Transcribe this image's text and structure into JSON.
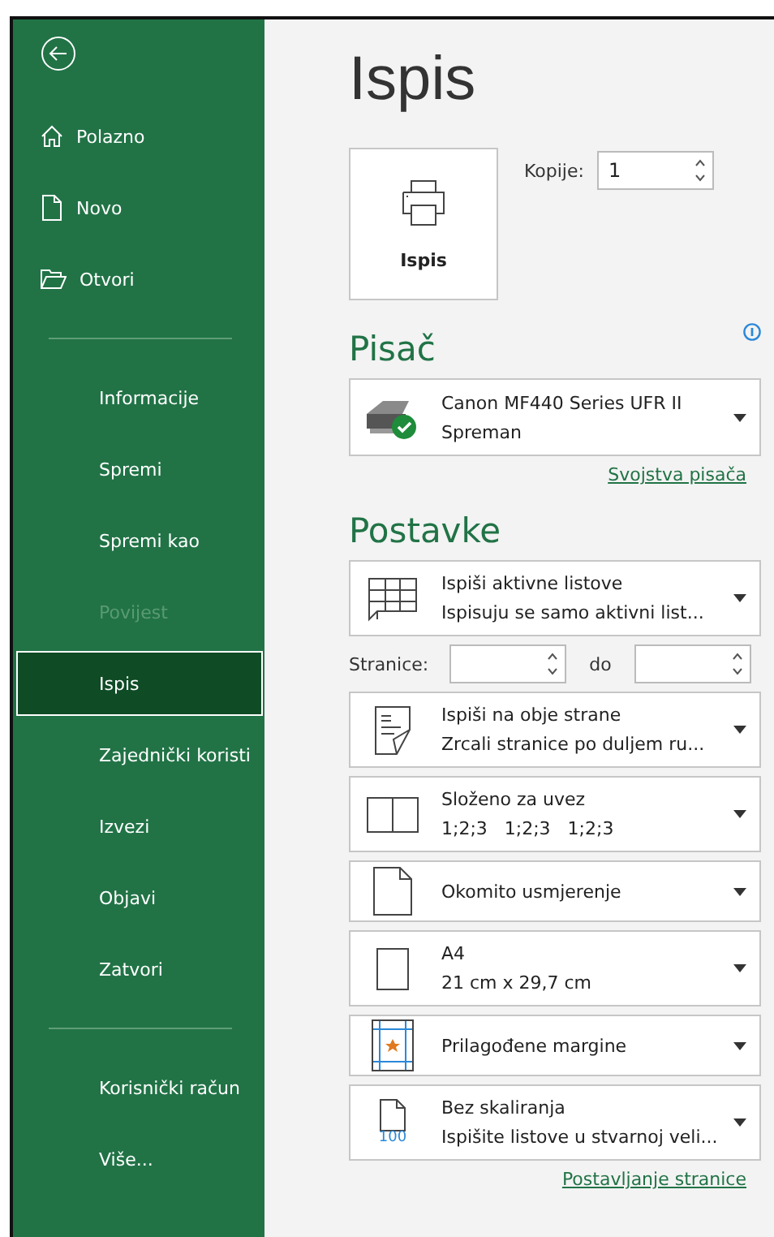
{
  "sidebar": {
    "items": [
      {
        "kind": "shortcut",
        "label": "Polazno",
        "selected": false,
        "disabled": false
      },
      {
        "kind": "shortcut",
        "label": "Novo",
        "selected": false,
        "disabled": false
      },
      {
        "kind": "shortcut",
        "label": "Otvori",
        "selected": false,
        "disabled": false
      },
      {
        "kind": "divider"
      },
      {
        "kind": "nav",
        "label": "Informacije",
        "selected": false,
        "disabled": false
      },
      {
        "kind": "nav",
        "label": "Spremi",
        "selected": false,
        "disabled": false
      },
      {
        "kind": "nav",
        "label": "Spremi kao",
        "selected": false,
        "disabled": false
      },
      {
        "kind": "nav",
        "label": "Povijest",
        "selected": false,
        "disabled": true
      },
      {
        "kind": "nav",
        "label": "Ispis",
        "selected": true,
        "disabled": false
      },
      {
        "kind": "nav",
        "label": "Zajednički koristi",
        "selected": false,
        "disabled": false
      },
      {
        "kind": "nav",
        "label": "Izvezi",
        "selected": false,
        "disabled": false
      },
      {
        "kind": "nav",
        "label": "Objavi",
        "selected": false,
        "disabled": false
      },
      {
        "kind": "nav",
        "label": "Zatvori",
        "selected": false,
        "disabled": false
      },
      {
        "kind": "divider"
      },
      {
        "kind": "nav",
        "label": "Korisnički račun",
        "selected": false,
        "disabled": false
      },
      {
        "kind": "nav",
        "label": "Više...",
        "selected": false,
        "disabled": false
      }
    ]
  },
  "title": "Ispis",
  "print_button": {
    "label": "Ispis"
  },
  "copies": {
    "label": "Kopije:",
    "value": "1"
  },
  "printer": {
    "heading": "Pisač",
    "name": "Canon MF440 Series UFR II",
    "status": "Spreman",
    "ready": true,
    "link": "Svojstva pisača"
  },
  "settings": {
    "heading": "Postavke",
    "items": [
      {
        "kind": "dropdown",
        "title": "Ispiši aktivne listove",
        "subtitle": "Ispisuju se samo aktivni list..."
      },
      {
        "kind": "pages",
        "label": "Stranice:",
        "to_label": "do"
      },
      {
        "kind": "dropdown",
        "title": "Ispiši na obje strane",
        "subtitle": "Zrcali stranice po duljem ru..."
      },
      {
        "kind": "dropdown",
        "title": "Složeno za uvez",
        "subtitle": "1;2;3   1;2;3   1;2;3"
      },
      {
        "kind": "dropdown",
        "title": "Okomito usmjerenje"
      },
      {
        "kind": "dropdown",
        "title": "A4",
        "subtitle": "21 cm x 29,7 cm"
      },
      {
        "kind": "dropdown",
        "title": "Prilagođene margine"
      },
      {
        "kind": "dropdown",
        "icon_text": "100",
        "title": "Bez skaliranja",
        "subtitle": "Ispišite listove u stvarnoj veli..."
      }
    ],
    "link": "Postavljanje stranice"
  }
}
